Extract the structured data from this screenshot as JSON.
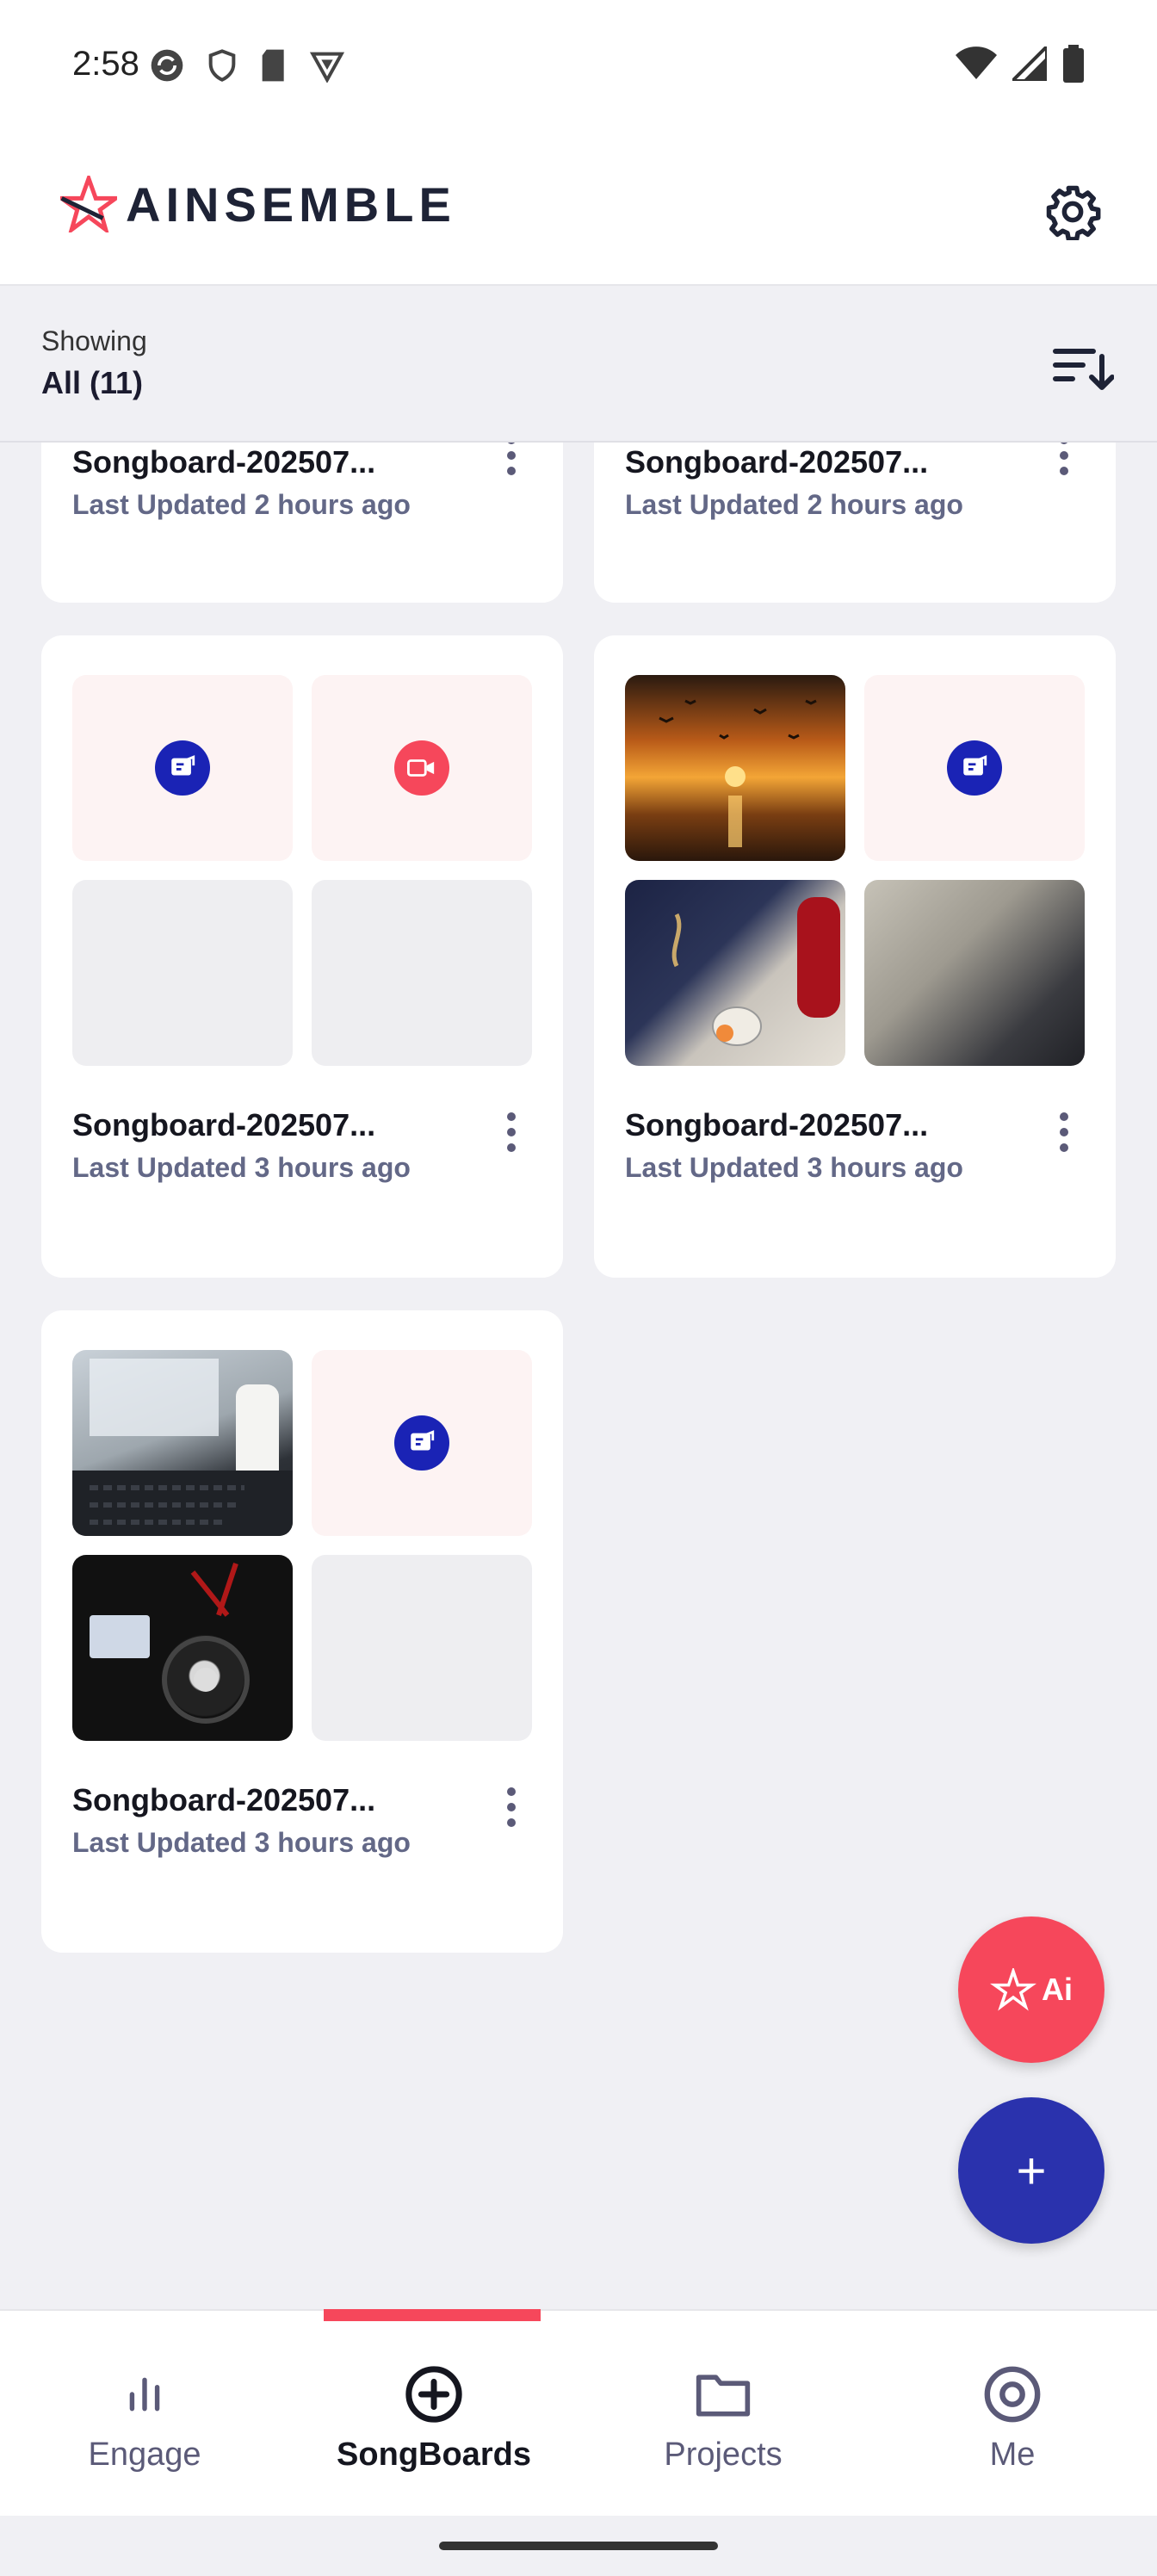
{
  "status_bar": {
    "time": "2:58"
  },
  "header": {
    "brand": "AINSEMBLE",
    "icons": {
      "settings": "gear-icon",
      "logo": "star-logo-icon"
    }
  },
  "filter": {
    "label": "Showing",
    "value": "All (11)",
    "sort_icon": "sort-icon"
  },
  "cards": [
    {
      "title": "Songboard-202507...",
      "subtitle": "Last Updated 2 hours ago"
    },
    {
      "title": "Songboard-202507...",
      "subtitle": "Last Updated 2 hours ago"
    },
    {
      "title": "Songboard-202507...",
      "subtitle": "Last Updated 3 hours ago",
      "thumbs": [
        "lyrics-icon",
        "video-icon",
        "empty",
        "empty"
      ]
    },
    {
      "title": "Songboard-202507...",
      "subtitle": "Last Updated 3 hours ago",
      "thumbs": [
        "photo-sunset",
        "lyrics-icon",
        "photo-fabric",
        "photo-blur"
      ]
    },
    {
      "title": "Songboard-202507...",
      "subtitle": "Last Updated 3 hours ago",
      "thumbs": [
        "photo-laptop",
        "lyrics-icon",
        "photo-dj",
        "empty"
      ]
    }
  ],
  "fab": {
    "ai_label": "Ai",
    "add_label": "+"
  },
  "bottom_nav": {
    "items": [
      {
        "label": "Engage",
        "icon": "bar-chart-icon"
      },
      {
        "label": "SongBoards",
        "icon": "add-circle-icon",
        "active": true
      },
      {
        "label": "Projects",
        "icon": "folder-icon"
      },
      {
        "label": "Me",
        "icon": "target-icon"
      }
    ]
  },
  "colors": {
    "accent": "#f6475b",
    "primary": "#2a32ad",
    "badge_blue": "#1a23b5"
  }
}
